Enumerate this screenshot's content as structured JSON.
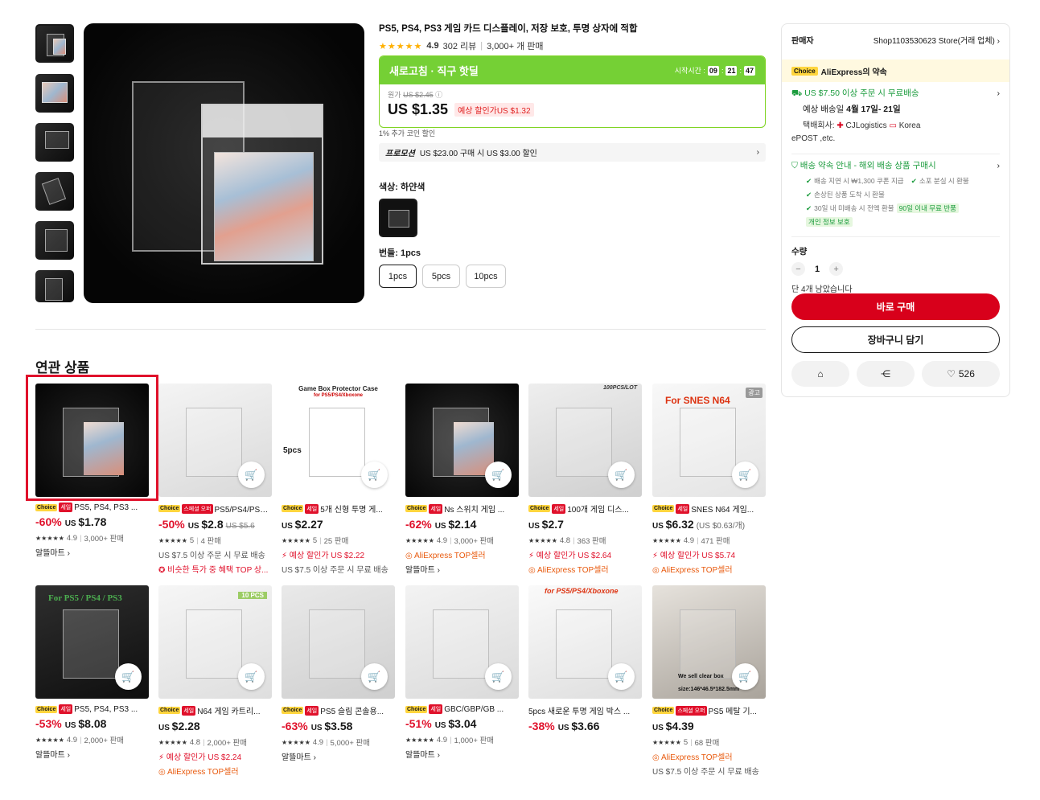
{
  "product": {
    "title": "PS5, PS4, PS3 게임 카드 디스플레이, 저장 보호, 투명 상자에 적합",
    "rating": "4.9",
    "reviews": "302 리뷰",
    "sold": "3,000+ 개 판매"
  },
  "deal": {
    "label": "새로고침 · 직구 핫딜",
    "timer_label": "시작시간 :",
    "timer": [
      "09",
      "21",
      "47"
    ],
    "orig_label": "원가",
    "orig_price": "US $2.45",
    "price": "US $1.35",
    "estimate": "예상 할인가US $1.32"
  },
  "coin_text": "1% 추가 코인 할인",
  "promo": {
    "label": "프로모션",
    "text": "US $23.00 구매 시 US $3.00 할인"
  },
  "color_label": "색상: 하얀색",
  "bundle_label": "번들: 1pcs",
  "bundles": [
    "1pcs",
    "5pcs",
    "10pcs"
  ],
  "seller": {
    "label": "판매자",
    "name": "Shop1103530623 Store(거래 업체)",
    "choice_tag": "Choice",
    "choice_text": "AliExpress의 약속",
    "shipping": "US $7.50 이상 주문 시 무료배송",
    "delivery_label": "예상 배송일",
    "delivery_date": "4월 17일- 21일",
    "carrier_label": "택배회사:",
    "carrier1": "CJLogistics",
    "carrier2": "Korea",
    "carrier3": "ePOST ,etc.",
    "promise": "배송 약속 안내 - 해외 배송 상품 구매시",
    "checks": [
      "배송 지연 시 ₩1,300 쿠폰 지급",
      "소포 분실 시 환불",
      "손상된 상품 도착 시 환불",
      "30일 내 미배송 시 전액 환불"
    ],
    "return_tag": "90일 이내 무료 반품",
    "privacy_tag": "개인 정보 보호",
    "qty_label": "수량",
    "qty": "1",
    "stock": "단 4개 남았습니다",
    "buy": "바로 구매",
    "cart": "장바구니 담기",
    "likes": "526"
  },
  "related_title": "연관 상품",
  "related": [
    {
      "tag": "Choice",
      "sale": "세일",
      "title": "PS5, PS4, PS3 ...",
      "disc": "-60%",
      "cur": "US",
      "price": "$1.78",
      "orig": "",
      "unit": "",
      "stars": "★★★★★",
      "rating": "4.9",
      "sold": "3,000+ 판매",
      "extra": "알뜰마트 ›",
      "extra2": "",
      "cls": "gray"
    },
    {
      "tag": "Choice",
      "sale": "스페셜 오퍼",
      "title": "PS5/PS4/PS3 디...",
      "disc": "-50%",
      "cur": "US",
      "price": "$2.8",
      "orig": "US $5.6",
      "unit": "",
      "stars": "★★★★★",
      "rating": "5",
      "sold": "4 판매",
      "extra": "US $7.5 이상 주문 시 무료 배송",
      "extra2": "비슷한 특가 중 혜택 TOP 상...",
      "cls": "gray"
    },
    {
      "tag": "Choice",
      "sale": "세일",
      "title": "5개 신형 투명 게...",
      "disc": "",
      "cur": "US",
      "price": "$2.27",
      "orig": "",
      "unit": "",
      "stars": "★★★★★",
      "rating": "5",
      "sold": "25 판매",
      "extra": "예상 할인가 US $2.22",
      "extra2": "US $7.5 이상 주문 시 무료 배송",
      "cls": "red"
    },
    {
      "tag": "Choice",
      "sale": "세일",
      "title": "Ns 스위치 게임 ...",
      "disc": "-62%",
      "cur": "US",
      "price": "$2.14",
      "orig": "",
      "unit": "",
      "stars": "★★★★★",
      "rating": "4.9",
      "sold": "3,000+ 판매",
      "extra": "AliExpress TOP셀러",
      "extra2": "알뜰마트 ›",
      "cls": "orange"
    },
    {
      "tag": "Choice",
      "sale": "세일",
      "title": "100개 게임 디스...",
      "disc": "",
      "cur": "US",
      "price": "$2.7",
      "orig": "",
      "unit": "",
      "stars": "★★★★★",
      "rating": "4.8",
      "sold": "363 판매",
      "extra": "예상 할인가 US $2.64",
      "extra2": "AliExpress TOP셀러",
      "cls": "red"
    },
    {
      "tag": "Choice",
      "sale": "세일",
      "title": "SNES N64 게임...",
      "disc": "",
      "cur": "US",
      "price": "$6.32",
      "orig": "",
      "unit": "(US $0.63/개)",
      "stars": "★★★★★",
      "rating": "4.9",
      "sold": "471 판매",
      "extra": "예상 할인가 US $5.74",
      "extra2": "AliExpress TOP셀러",
      "cls": "red"
    },
    {
      "tag": "Choice",
      "sale": "세일",
      "title": "PS5, PS4, PS3 ...",
      "disc": "-53%",
      "cur": "US",
      "price": "$8.08",
      "orig": "",
      "unit": "",
      "stars": "★★★★★",
      "rating": "4.9",
      "sold": "2,000+ 판매",
      "extra": "알뜰마트 ›",
      "extra2": "",
      "cls": "gray"
    },
    {
      "tag": "Choice",
      "sale": "세일",
      "title": "N64 게임 카트리...",
      "disc": "",
      "cur": "US",
      "price": "$2.28",
      "orig": "",
      "unit": "",
      "stars": "★★★★★",
      "rating": "4.8",
      "sold": "2,000+ 판매",
      "extra": "예상 할인가 US $2.24",
      "extra2": "AliExpress TOP셀러",
      "cls": "red"
    },
    {
      "tag": "Choice",
      "sale": "세일",
      "title": "PS5 슬림 콘솔용...",
      "disc": "-63%",
      "cur": "US",
      "price": "$3.58",
      "orig": "",
      "unit": "",
      "stars": "★★★★★",
      "rating": "4.9",
      "sold": "5,000+ 판매",
      "extra": "알뜰마트 ›",
      "extra2": "",
      "cls": "gray"
    },
    {
      "tag": "Choice",
      "sale": "세일",
      "title": "GBC/GBP/GB ...",
      "disc": "-51%",
      "cur": "US",
      "price": "$3.04",
      "orig": "",
      "unit": "",
      "stars": "★★★★★",
      "rating": "4.9",
      "sold": "1,000+ 판매",
      "extra": "알뜰마트 ›",
      "extra2": "",
      "cls": "gray"
    },
    {
      "tag": "",
      "sale": "",
      "title": "5pcs 새로운 투명 게임 박스 ...",
      "disc": "-38%",
      "cur": "US",
      "price": "$3.66",
      "orig": "",
      "unit": "",
      "stars": "",
      "rating": "",
      "sold": "",
      "extra": "",
      "extra2": "",
      "cls": "gray"
    },
    {
      "tag": "Choice",
      "sale": "스페셜 오퍼",
      "title": "PS5 메탈 기...",
      "disc": "",
      "cur": "US",
      "price": "$4.39",
      "orig": "",
      "unit": "",
      "stars": "★★★★★",
      "rating": "5",
      "sold": "68 판매",
      "extra": "AliExpress TOP셀러",
      "extra2": "US $7.5 이상 주문 시 무료 배송",
      "cls": "orange"
    }
  ],
  "image_texts": {
    "p3": "Game Box Protector Case",
    "p3b": "for PS5/PS4/Xboxone",
    "p3c": "5pcs",
    "p5": "100PCS/LOT",
    "p6": "For SNES N64",
    "p6ad": "광고",
    "p7": "For PS5 / PS4 / PS3",
    "p8": "10 PCS",
    "p11": "for PS5/PS4/Xboxone",
    "p12": "We sell clear box",
    "p12b": "size:146*46.5*182.5mm"
  }
}
